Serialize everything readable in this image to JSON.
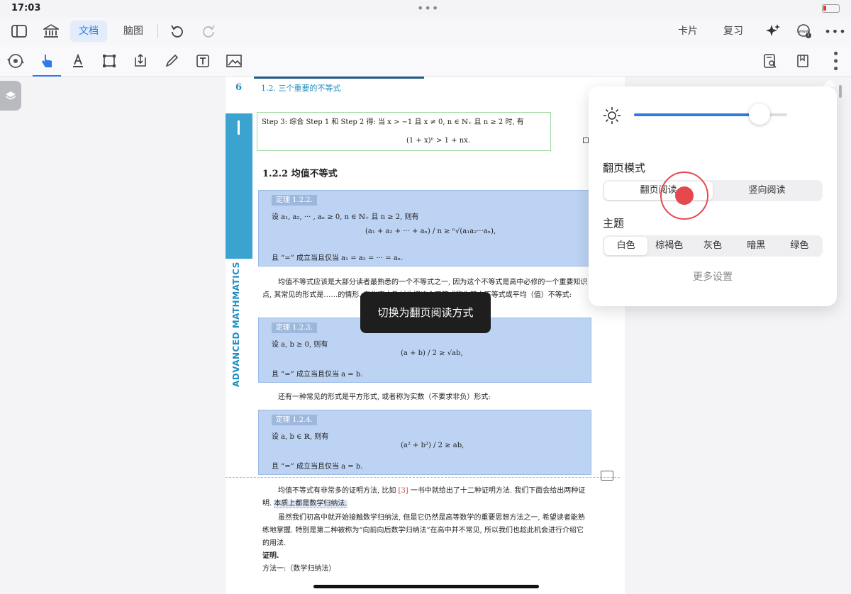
{
  "status": {
    "time": "17:03"
  },
  "toolbar": {
    "tab_doc": "文档",
    "tab_mind": "脑图",
    "card": "卡片",
    "review": "复习"
  },
  "page": {
    "number": "6",
    "header": "1.2.  三个重要的不等式",
    "side_text": "ADVANCED MATHMATICS",
    "step_line1": "Step 3: 综合 Step 1 和 Step 2 得: 当 x > −1 且 x ≠ 0, n ∈ ℕ₊ 且 n ≥ 2 时, 有",
    "step_line2": "(1 + x)ⁿ > 1 + nx.",
    "section": "1.2.2    均值不等式",
    "thm1": {
      "tag": "定理 1.2.2.",
      "line1": "设 a₁, a₂, ··· , aₙ ≥ 0, n ∈ ℕ₊ 且 n ≥ 2, 则有",
      "formula": "(a₁ + a₂ + ··· + aₙ) / n  ≥  ⁿ√(a₁a₂···aₙ),",
      "line3": "且 “=” 成立当且仅当 a₁ = a₂ = ··· = aₙ."
    },
    "para1": "均值不等式应该是大部分读者最熟悉的一个不等式之一, 因为这个不等式是高中必修的一个重要知识点, 其常见的形式是……的情形. 有些高中教材也把这个不等式称为基本不等式或平均（值）不等式:",
    "thm2": {
      "tag": "定理 1.2.3.",
      "line1": "设 a, b ≥ 0, 则有",
      "formula": "(a + b) / 2  ≥  √ab,",
      "line3": "且 “=” 成立当且仅当 a = b."
    },
    "para2": "还有一种常见的形式是平方形式, 或者称为实数（不要求非负）形式:",
    "thm3": {
      "tag": "定理 1.2.4.",
      "line1": "设 a, b ∈ ℝ, 则有",
      "formula": "(a² + b²) / 2  ≥  ab,",
      "line3": "且 “=” 成立当且仅当 a = b."
    },
    "para3a": "均值不等式有非常多的证明方法, 比如",
    "para3cite": "[3]",
    "para3b": "一书中就给出了十二种证明方法. 我们下面会给出两种证明.",
    "para3hl": "本质上都是数学归纳法.",
    "para4": "虽然我们初高中就开始接触数学归纳法, 但是它仍然是高等数学的重要思想方法之一, 希望读者能熟练地掌握. 特别是第二种被称为“向前向后数学归纳法”在高中并不常见, 所以我们也趁此机会进行介绍它的用法.",
    "proof": "证明.",
    "method1": "方法一:（数学归纳法）"
  },
  "toast": "切换为翻页阅读方式",
  "panel": {
    "brightness": 0.82,
    "flip_label": "翻页模式",
    "flip_options": [
      "翻页阅读",
      "竖向阅读"
    ],
    "flip_selected": 0,
    "theme_label": "主题",
    "theme_options": [
      "白色",
      "棕褐色",
      "灰色",
      "暗黑",
      "绿色"
    ],
    "theme_selected": 0,
    "more": "更多设置"
  },
  "colors": {
    "accent": "#2f7ae5",
    "touch": "#e5484d",
    "theorem_bg": "#bcd3f3"
  }
}
